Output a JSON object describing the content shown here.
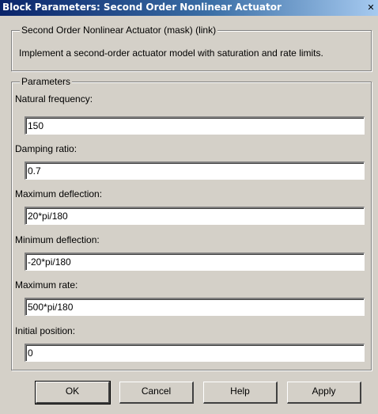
{
  "window": {
    "title": "Block Parameters: Second Order Nonlinear Actuator",
    "close_glyph": "✕"
  },
  "mask_group": {
    "legend": "Second Order Nonlinear Actuator (mask) (link)",
    "description": "Implement a second-order actuator model with saturation and rate limits."
  },
  "params_group": {
    "legend": "Parameters",
    "fields": [
      {
        "label": "Natural frequency:",
        "value": "150"
      },
      {
        "label": "Damping ratio:",
        "value": "0.7"
      },
      {
        "label": "Maximum deflection:",
        "value": "20*pi/180"
      },
      {
        "label": "Minimum deflection:",
        "value": "-20*pi/180"
      },
      {
        "label": "Maximum rate:",
        "value": "500*pi/180"
      },
      {
        "label": "Initial position:",
        "value": "0"
      }
    ]
  },
  "buttons": {
    "ok": "OK",
    "cancel": "Cancel",
    "help": "Help",
    "apply": "Apply"
  },
  "colors": {
    "face": "#d4d0c8",
    "title_start": "#0a246a",
    "title_end": "#a6caf0"
  }
}
